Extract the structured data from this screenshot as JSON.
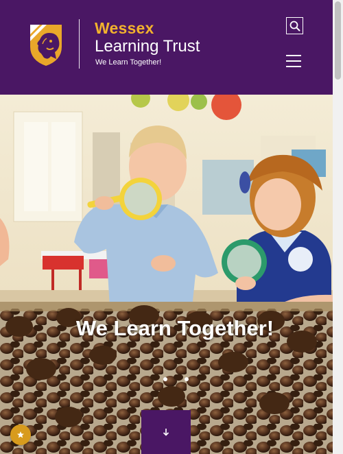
{
  "header": {
    "brand_name": "Wessex",
    "brand_subtitle": "Learning Trust",
    "tagline": "We Learn Together!",
    "logo_icon": "lion-shield-icon",
    "search_icon": "search-icon",
    "menu_icon": "hamburger-menu-icon",
    "colors": {
      "background": "#4a1764",
      "accent": "#f2b22d",
      "text": "#ffffff"
    }
  },
  "hero": {
    "title": "We Learn Together!",
    "image_description_icon": "children-with-magnifying-glasses-photo",
    "slides": 2,
    "active_slide": 1,
    "scroll_icon": "arrow-down-icon",
    "badge_icon": "star-badge-icon"
  }
}
